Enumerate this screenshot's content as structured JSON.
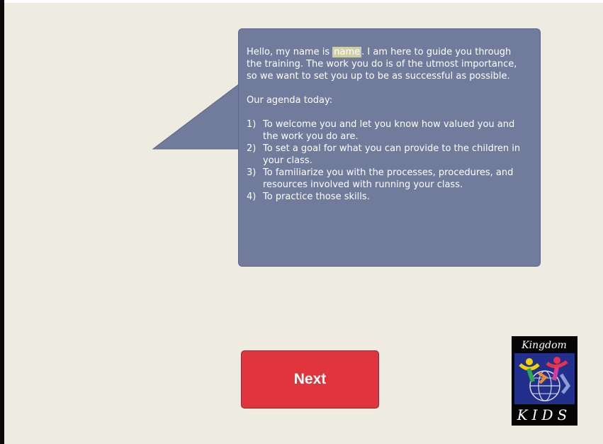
{
  "bubble": {
    "greeting_pre": "Hello, my name is ",
    "name_placeholder": "name",
    "greeting_post": ".  I am here to guide you through the training.  The work you do is of the utmost importance, so we want to set you up to be as successful as possible.",
    "agenda_heading": "Our agenda today:",
    "agenda": [
      {
        "num": "1)",
        "text": "To welcome you and let you know how valued you and the work you do are."
      },
      {
        "num": "2)",
        "text": "To set a goal for what you can provide to the children in your class."
      },
      {
        "num": "3)",
        "text": "To familiarize you with the processes, procedures, and resources involved with running your class."
      },
      {
        "num": "4)",
        "text": "To practice those skills."
      }
    ]
  },
  "buttons": {
    "next_label": "Next"
  },
  "logo": {
    "top_text": "Kingdom",
    "bottom_text": "KIDS"
  },
  "colors": {
    "slide_bg": "#eeece1",
    "bubble": "#717b9c",
    "next_button": "#e0353c",
    "name_highlight": "#cfcfa6"
  }
}
